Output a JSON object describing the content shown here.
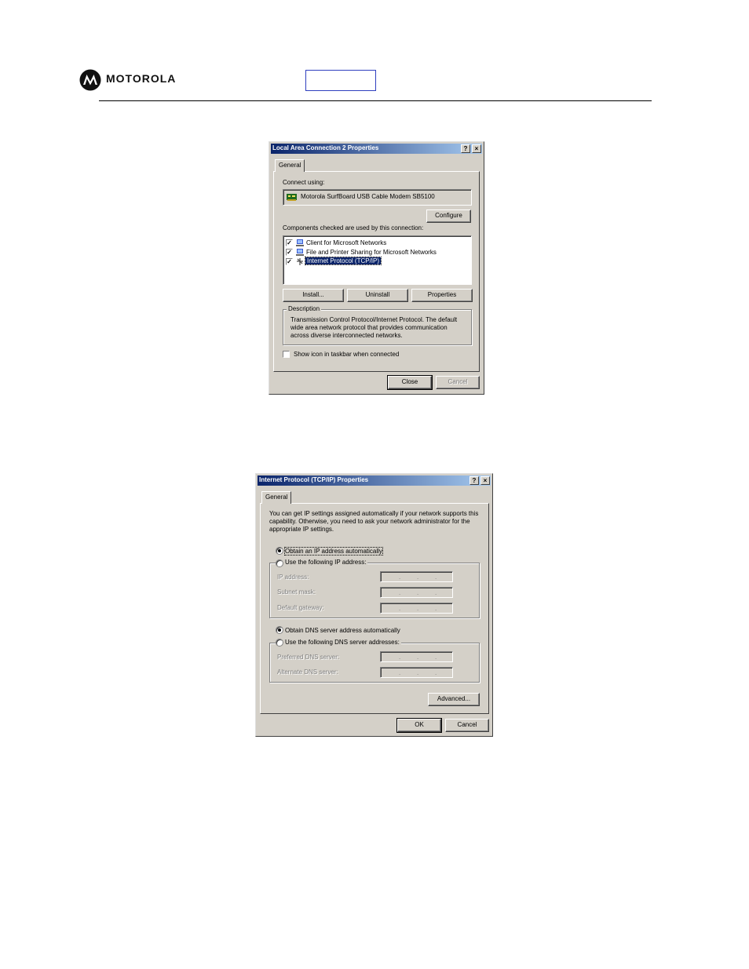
{
  "header": {
    "brand": "MOTOROLA"
  },
  "dialog1": {
    "title": "Local Area Connection 2 Properties",
    "help_btn": "?",
    "close_btn": "×",
    "tab": "General",
    "connect_using_label": "Connect using:",
    "adapter_name": "Motorola SurfBoard USB Cable Modem SB5100",
    "configure_btn": "Configure",
    "components_label": "Components checked are used by this connection:",
    "components": [
      {
        "label": "Client for Microsoft Networks",
        "checked": true
      },
      {
        "label": "File and Printer Sharing for Microsoft Networks",
        "checked": true
      },
      {
        "label": "Internet Protocol (TCP/IP)",
        "checked": true,
        "selected": true
      }
    ],
    "install_btn": "Install...",
    "uninstall_btn": "Uninstall",
    "properties_btn": "Properties",
    "description_label": "Description",
    "description_text": "Transmission Control Protocol/Internet Protocol. The default wide area network protocol that provides communication across diverse interconnected networks.",
    "show_icon_label": "Show icon in taskbar when connected",
    "close_button": "Close",
    "cancel_button": "Cancel"
  },
  "dialog2": {
    "title": "Internet Protocol (TCP/IP) Properties",
    "help_btn": "?",
    "close_btn": "×",
    "tab": "General",
    "intro": "You can get IP settings assigned automatically if your network supports this capability. Otherwise, you need to ask your network administrator for the appropriate IP settings.",
    "obtain_ip_auto": "Obtain an IP address automatically",
    "use_following_ip": "Use the following IP address:",
    "ip_address_label": "IP address:",
    "subnet_mask_label": "Subnet mask:",
    "default_gateway_label": "Default gateway:",
    "obtain_dns_auto": "Obtain DNS server address automatically",
    "use_following_dns": "Use the following DNS server addresses:",
    "preferred_dns_label": "Preferred DNS server:",
    "alternate_dns_label": "Alternate DNS server:",
    "ip_dot": ".",
    "advanced_btn": "Advanced...",
    "ok_btn": "OK",
    "cancel_btn": "Cancel"
  },
  "colors": {
    "titlebar_start": "#0a246a",
    "titlebar_end": "#a6caf0",
    "dialog_face": "#d4d0c8",
    "selection": "#0a246a",
    "header_box_border": "#2f3fbf"
  }
}
